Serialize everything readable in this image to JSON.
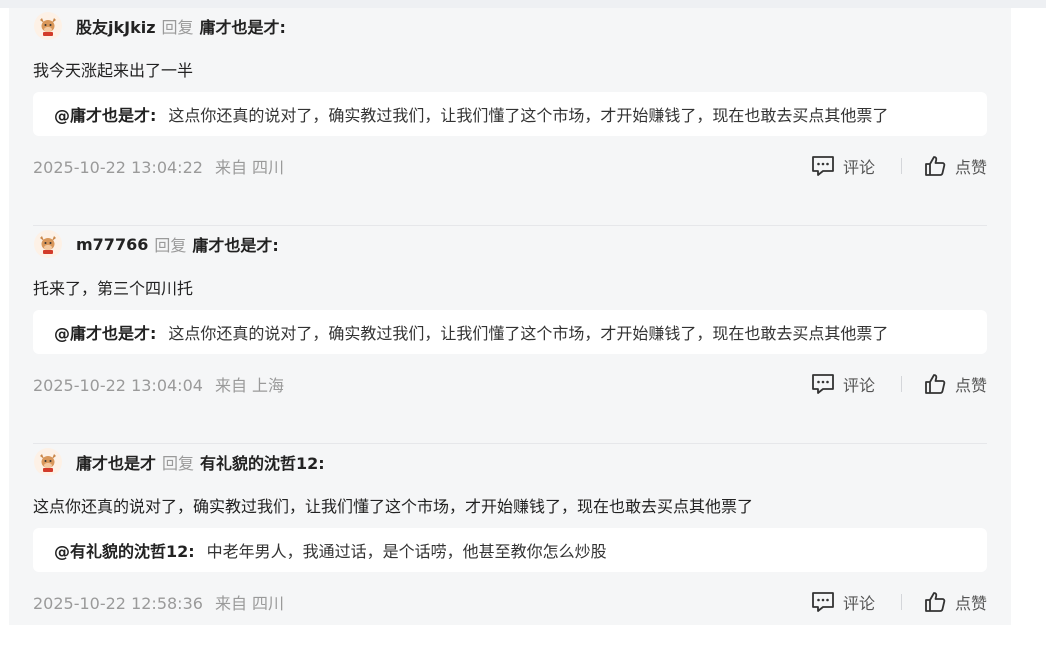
{
  "replies": [
    {
      "user": "股友jkJkiz",
      "reply_word": "回复",
      "target": "庸才也是才:",
      "content": "我今天涨起来出了一半",
      "quote_user": "@庸才也是才:",
      "quote_text": "这点你还真的说对了，确实教过我们，让我们懂了这个市场，才开始赚钱了，现在也敢去买点其他票了",
      "time": "2025-10-22 13:04:22",
      "location": "来自 四川",
      "comment_label": "评论",
      "like_label": "点赞"
    },
    {
      "user": "m77766",
      "reply_word": "回复",
      "target": "庸才也是才:",
      "content": "托来了，第三个四川托",
      "quote_user": "@庸才也是才:",
      "quote_text": "这点你还真的说对了，确实教过我们，让我们懂了这个市场，才开始赚钱了，现在也敢去买点其他票了",
      "time": "2025-10-22 13:04:04",
      "location": "来自 上海",
      "comment_label": "评论",
      "like_label": "点赞"
    },
    {
      "user": "庸才也是才",
      "reply_word": "回复",
      "target": "有礼貌的沈哲12:",
      "content": "这点你还真的说对了，确实教过我们，让我们懂了这个市场，才开始赚钱了，现在也敢去买点其他票了",
      "quote_user": "@有礼貌的沈哲12:",
      "quote_text": "中老年男人，我通过话，是个话唠，他甚至教你怎么炒股",
      "time": "2025-10-22 12:58:36",
      "location": "来自 四川",
      "comment_label": "评论",
      "like_label": "点赞"
    }
  ],
  "icons": {
    "avatar": "cow-avatar-icon",
    "comment": "comment-icon",
    "like": "thumbs-up-icon"
  }
}
